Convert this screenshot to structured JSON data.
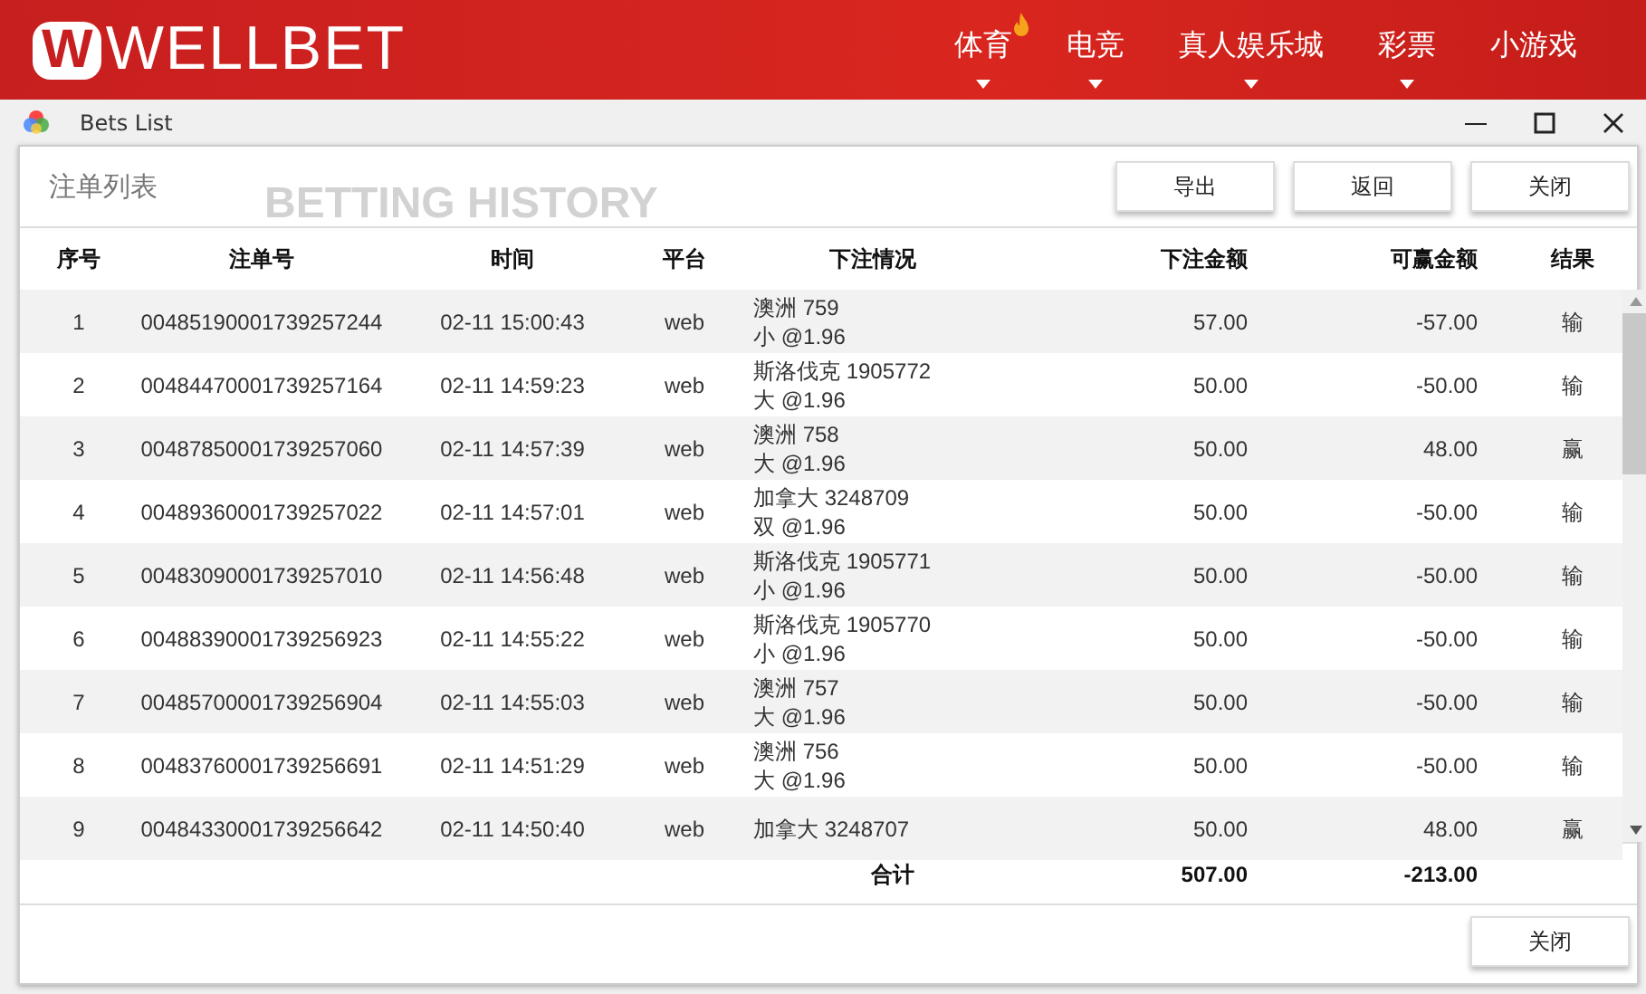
{
  "site": {
    "logo_mark": "W",
    "logo_text": "WELLBET",
    "nav": [
      {
        "label": "体育",
        "hot": true,
        "dropdown": true
      },
      {
        "label": "电竞",
        "hot": false,
        "dropdown": true
      },
      {
        "label": "真人娱乐城",
        "hot": false,
        "dropdown": true
      },
      {
        "label": "彩票",
        "hot": false,
        "dropdown": true
      },
      {
        "label": "小游戏",
        "hot": false,
        "dropdown": false
      }
    ]
  },
  "window": {
    "title": "Bets List"
  },
  "panel": {
    "title": "注单列表",
    "background_heading": "BETTING HISTORY",
    "buttons": [
      "导出",
      "返回",
      "关闭"
    ]
  },
  "table": {
    "columns": [
      "序号",
      "注单号",
      "时间",
      "平台",
      "下注情况",
      "下注金额",
      "可赢金额",
      "结果"
    ],
    "rows": [
      {
        "no": "1",
        "id": "00485190001739257244",
        "time": "02-11 15:00:43",
        "platform": "web",
        "bet": [
          "澳洲 759",
          "小 @1.96"
        ],
        "stake": "57.00",
        "win": "-57.00",
        "result": "输"
      },
      {
        "no": "2",
        "id": "00484470001739257164",
        "time": "02-11 14:59:23",
        "platform": "web",
        "bet": [
          "斯洛伐克 1905772",
          "大 @1.96"
        ],
        "stake": "50.00",
        "win": "-50.00",
        "result": "输"
      },
      {
        "no": "3",
        "id": "00487850001739257060",
        "time": "02-11 14:57:39",
        "platform": "web",
        "bet": [
          "澳洲 758",
          "大 @1.96"
        ],
        "stake": "50.00",
        "win": "48.00",
        "result": "赢"
      },
      {
        "no": "4",
        "id": "00489360001739257022",
        "time": "02-11 14:57:01",
        "platform": "web",
        "bet": [
          "加拿大 3248709",
          "双 @1.96"
        ],
        "stake": "50.00",
        "win": "-50.00",
        "result": "输"
      },
      {
        "no": "5",
        "id": "00483090001739257010",
        "time": "02-11 14:56:48",
        "platform": "web",
        "bet": [
          "斯洛伐克 1905771",
          "小 @1.96"
        ],
        "stake": "50.00",
        "win": "-50.00",
        "result": "输"
      },
      {
        "no": "6",
        "id": "00488390001739256923",
        "time": "02-11 14:55:22",
        "platform": "web",
        "bet": [
          "斯洛伐克 1905770",
          "小 @1.96"
        ],
        "stake": "50.00",
        "win": "-50.00",
        "result": "输"
      },
      {
        "no": "7",
        "id": "00485700001739256904",
        "time": "02-11 14:55:03",
        "platform": "web",
        "bet": [
          "澳洲 757",
          "大 @1.96"
        ],
        "stake": "50.00",
        "win": "-50.00",
        "result": "输"
      },
      {
        "no": "8",
        "id": "00483760001739256691",
        "time": "02-11 14:51:29",
        "platform": "web",
        "bet": [
          "澳洲 756",
          "大 @1.96"
        ],
        "stake": "50.00",
        "win": "-50.00",
        "result": "输"
      },
      {
        "no": "9",
        "id": "00484330001739256642",
        "time": "02-11 14:50:40",
        "platform": "web",
        "bet": [
          "加拿大 3248707"
        ],
        "stake": "50.00",
        "win": "48.00",
        "result": "赢"
      }
    ],
    "total": {
      "label": "合计",
      "stake": "507.00",
      "win": "-213.00"
    }
  },
  "footer": {
    "button": "关闭"
  }
}
